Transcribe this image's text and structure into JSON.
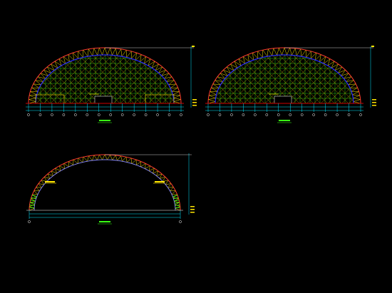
{
  "drawing": {
    "background": "#000000",
    "colors": {
      "truss_outer": "#ff3b30",
      "truss_web": "#ffe600",
      "truss_inner_chord": "#2a2aff",
      "infill": "#39ff14",
      "grid_line": "#00e5ff",
      "dim_line": "#ffffff",
      "leader": "#ffe600",
      "base_red": "#d00000"
    },
    "views": [
      {
        "id": "elevation-a",
        "label": "",
        "has_infill": true,
        "has_side_frames": true
      },
      {
        "id": "elevation-b",
        "label": "",
        "has_infill": true,
        "has_side_frames": false
      },
      {
        "id": "section-c",
        "label": "",
        "has_infill": false,
        "has_side_frames": false
      }
    ]
  }
}
